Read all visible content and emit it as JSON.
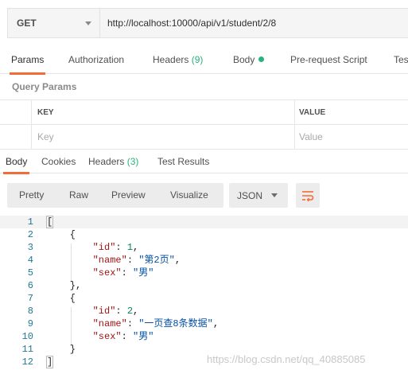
{
  "request": {
    "method": "GET",
    "url": "http://localhost:10000/api/v1/student/2/8"
  },
  "request_tabs": [
    {
      "label": "Params",
      "active": true
    },
    {
      "label": "Authorization"
    },
    {
      "label": "Headers",
      "count": "(9)"
    },
    {
      "label": "Body",
      "has_dot": true
    },
    {
      "label": "Pre-request Script"
    },
    {
      "label": "Tes"
    }
  ],
  "query_params": {
    "title": "Query Params",
    "key_header": "KEY",
    "value_header": "VALUE",
    "key_placeholder": "Key",
    "value_placeholder": "Value"
  },
  "response_tabs": [
    {
      "label": "Body",
      "active": true
    },
    {
      "label": "Cookies"
    },
    {
      "label": "Headers",
      "count": "(3)"
    },
    {
      "label": "Test Results"
    }
  ],
  "format_buttons": [
    "Pretty",
    "Raw",
    "Preview",
    "Visualize"
  ],
  "format_select": "JSON",
  "code_lines": [
    {
      "n": "1",
      "tokens": [
        {
          "t": "[",
          "c": "p",
          "box": true
        }
      ]
    },
    {
      "n": "2",
      "tokens": [
        {
          "t": "    {",
          "c": "p"
        }
      ]
    },
    {
      "n": "3",
      "tokens": [
        {
          "t": "        ",
          "c": "p"
        },
        {
          "t": "\"id\"",
          "c": "key"
        },
        {
          "t": ": ",
          "c": "p"
        },
        {
          "t": "1",
          "c": "num"
        },
        {
          "t": ",",
          "c": "p"
        }
      ]
    },
    {
      "n": "4",
      "tokens": [
        {
          "t": "        ",
          "c": "p"
        },
        {
          "t": "\"name\"",
          "c": "key"
        },
        {
          "t": ": ",
          "c": "p"
        },
        {
          "t": "\"第2页\"",
          "c": "str"
        },
        {
          "t": ",",
          "c": "p"
        }
      ]
    },
    {
      "n": "5",
      "tokens": [
        {
          "t": "        ",
          "c": "p"
        },
        {
          "t": "\"sex\"",
          "c": "key"
        },
        {
          "t": ": ",
          "c": "p"
        },
        {
          "t": "\"男\"",
          "c": "str"
        }
      ]
    },
    {
      "n": "6",
      "tokens": [
        {
          "t": "    },",
          "c": "p"
        }
      ]
    },
    {
      "n": "7",
      "tokens": [
        {
          "t": "    {",
          "c": "p"
        }
      ]
    },
    {
      "n": "8",
      "tokens": [
        {
          "t": "        ",
          "c": "p"
        },
        {
          "t": "\"id\"",
          "c": "key"
        },
        {
          "t": ": ",
          "c": "p"
        },
        {
          "t": "2",
          "c": "num"
        },
        {
          "t": ",",
          "c": "p"
        }
      ]
    },
    {
      "n": "9",
      "tokens": [
        {
          "t": "        ",
          "c": "p"
        },
        {
          "t": "\"name\"",
          "c": "key"
        },
        {
          "t": ": ",
          "c": "p"
        },
        {
          "t": "\"一页查8条数据\"",
          "c": "str"
        },
        {
          "t": ",",
          "c": "p"
        }
      ]
    },
    {
      "n": "10",
      "tokens": [
        {
          "t": "        ",
          "c": "p"
        },
        {
          "t": "\"sex\"",
          "c": "key"
        },
        {
          "t": ": ",
          "c": "p"
        },
        {
          "t": "\"男\"",
          "c": "str"
        }
      ]
    },
    {
      "n": "11",
      "tokens": [
        {
          "t": "    }",
          "c": "p"
        }
      ]
    },
    {
      "n": "12",
      "tokens": [
        {
          "t": "]",
          "c": "p",
          "box": true
        }
      ]
    }
  ],
  "watermark": "https://blog.csdn.net/qq_40885085",
  "colors": {
    "accent": "#f26b3a",
    "count_green": "#26b47f",
    "json_key": "#a31515",
    "json_string": "#0451a5",
    "json_number": "#098658",
    "line_number": "#237893"
  }
}
